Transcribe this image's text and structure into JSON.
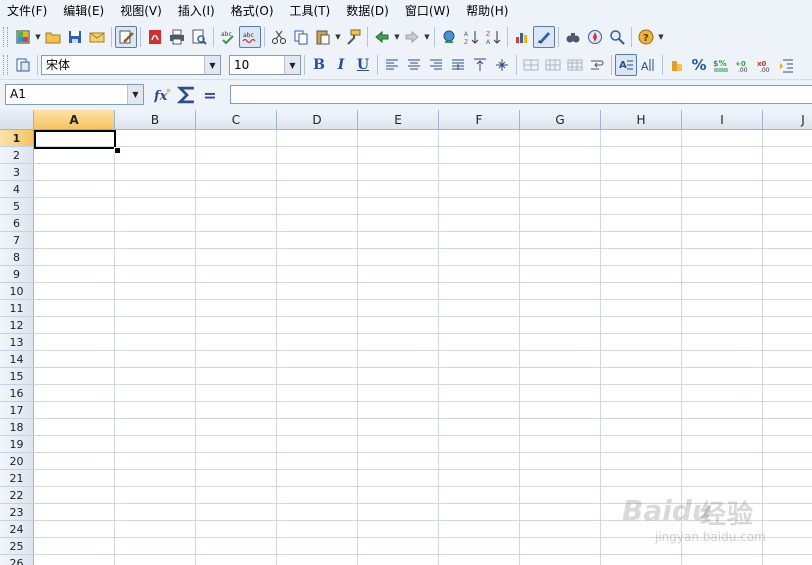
{
  "menu": [
    "文件(F)",
    "编辑(E)",
    "视图(V)",
    "插入(I)",
    "格式(O)",
    "工具(T)",
    "数据(D)",
    "窗口(W)",
    "帮助(H)"
  ],
  "toolbar_standard": [
    "new-document-icon",
    "open-folder-icon",
    "save-icon",
    "email-icon",
    "edit-mode-icon",
    "export-pdf-icon",
    "print-icon",
    "print-preview-icon",
    "spellcheck-icon",
    "auto-spellcheck-icon",
    "cut-icon",
    "copy-icon",
    "paste-icon",
    "format-painter-icon",
    "undo-icon",
    "redo-icon",
    "hyperlink-icon",
    "sort-ascending-icon",
    "sort-descending-icon",
    "chart-icon",
    "draw-functions-icon",
    "find-replace-icon",
    "navigator-icon",
    "zoom-icon",
    "help-icon"
  ],
  "toolbar_formatting": {
    "font_name": "宋体",
    "font_size": "10",
    "buttons": [
      "bold",
      "italic",
      "underline",
      "align-left",
      "align-center",
      "align-right",
      "align-justify",
      "align-top",
      "align-middle",
      "align-bottom",
      "merge-cells",
      "wrap-text",
      "number-format-currency",
      "number-format-percent",
      "number-format-standard",
      "add-decimal",
      "delete-decimal",
      "indent"
    ]
  },
  "formula_bar": {
    "cell_ref": "A1",
    "formula": "",
    "function_wizard": "function-wizard-icon",
    "sum": "sum-icon",
    "equals": "="
  },
  "sheet": {
    "columns": [
      "A",
      "B",
      "C",
      "D",
      "E",
      "F",
      "G",
      "H",
      "I",
      "J"
    ],
    "rows": [
      "1",
      "2",
      "3",
      "4",
      "5",
      "6",
      "7",
      "8",
      "9",
      "10",
      "11",
      "12",
      "13",
      "14",
      "15",
      "16",
      "17",
      "18",
      "19",
      "20",
      "21",
      "22",
      "23",
      "24",
      "25",
      "26"
    ],
    "selected_cell": "A1"
  },
  "watermark": {
    "brand": "Baidu",
    "text": "经验",
    "url": "jingyan.baidu.com"
  },
  "colors": {
    "chrome": "#eef3fa",
    "header_selected": "#f5c462",
    "grid_line": "#d0d7e3",
    "header_border": "#9eb6ce"
  }
}
